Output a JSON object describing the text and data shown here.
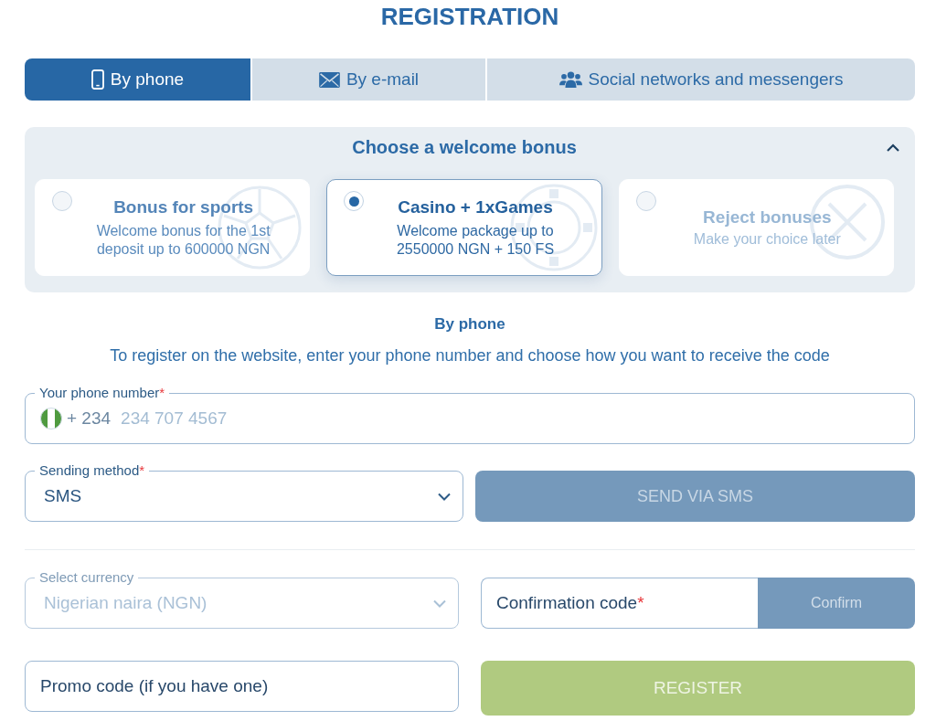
{
  "title": "REGISTRATION",
  "tabs": [
    {
      "kind": "phone",
      "label": "By phone",
      "selected": true
    },
    {
      "kind": "email",
      "label": "By e-mail",
      "selected": false
    },
    {
      "kind": "social",
      "label": "Social networks and messengers",
      "selected": false
    }
  ],
  "bonus": {
    "title": "Choose a welcome bonus",
    "expanded": true,
    "options": [
      {
        "kind": "sports",
        "title": "Bonus for sports",
        "description": "Welcome bonus for the 1st deposit up to 600000 NGN",
        "selected": false
      },
      {
        "kind": "casino",
        "title": "Casino + 1xGames",
        "description": "Welcome package up to 2550000 NGN + 150 FS",
        "selected": true
      },
      {
        "kind": "reject",
        "title": "Reject bonuses",
        "description": "Make your choice later",
        "selected": false
      }
    ]
  },
  "form": {
    "heading": "By phone",
    "instructions": "To register on the website, enter your phone number and choose how you want to receive the code",
    "phone": {
      "label": "Your phone number",
      "required_mark": "*",
      "country_code": "+ 234",
      "placeholder": "234 707 4567"
    },
    "sending_method": {
      "label": "Sending method",
      "required_mark": "*",
      "value": "SMS"
    },
    "send_button": {
      "label": "SEND VIA SMS",
      "disabled": true
    },
    "currency": {
      "label": "Select currency",
      "value": "Nigerian naira (NGN)",
      "disabled": true
    },
    "confirmation": {
      "placeholder": "Confirmation code",
      "required_mark": "*",
      "button": "Confirm",
      "disabled": true
    },
    "promo": {
      "placeholder": "Promo code (if you have one)"
    },
    "register_button": {
      "label": "REGISTER",
      "disabled": true
    }
  }
}
